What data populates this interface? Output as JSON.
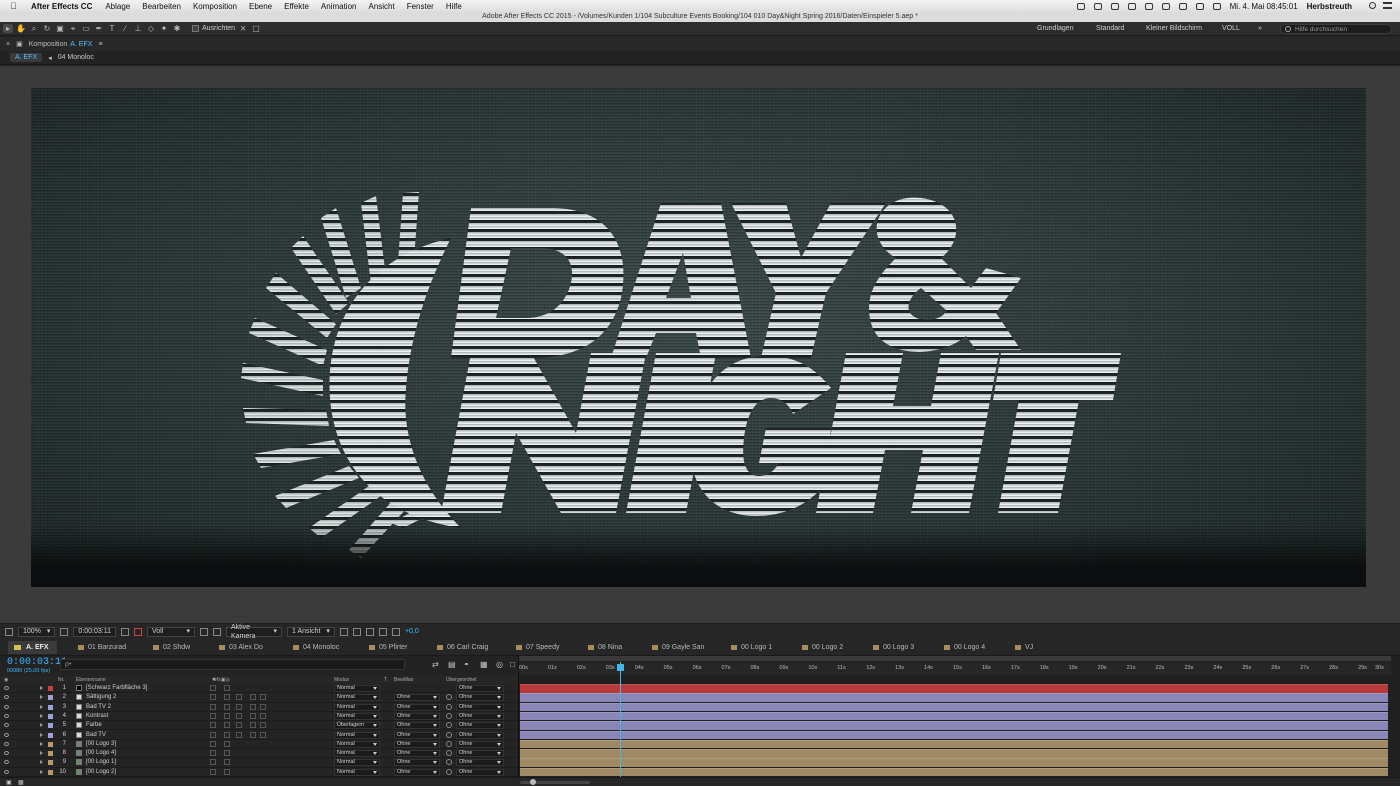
{
  "menubar": {
    "app_name": "After Effects CC",
    "items": [
      "Ablage",
      "Bearbeiten",
      "Komposition",
      "Ebene",
      "Effekte",
      "Animation",
      "Ansicht",
      "Fenster",
      "Hilfe"
    ],
    "clock": "Mi. 4. Mai  08:45:01",
    "user": "Herbstreuth"
  },
  "window_title": "Adobe After Effects CC 2015 - /Volumes/Kunden 1/104 Subculture Events Booking/104 010 Day&Night Spring 2016/Daten/Einspieler 5.aep *",
  "toolbar": {
    "snap_label": "Ausrichten",
    "workspaces": [
      "Grundlagen",
      "Standard",
      "Kleiner Bildschirm",
      "VOLL"
    ],
    "search_placeholder": "Hilfe durchsuchen"
  },
  "composition_panel": {
    "header_label": "Komposition",
    "comp_name": "A. EFX",
    "breadcrumb": [
      "A. EFX",
      "04 Monoloc"
    ]
  },
  "viewer_controls": {
    "zoom": "100%",
    "timecode": "0:00:03:11",
    "resolution": "Voll",
    "camera": "Aktive Kamera",
    "views": "1 Ansicht",
    "exposure": "+0,0"
  },
  "timeline_tabs": [
    "A. EFX",
    "01 Barzurad",
    "02 Shdw",
    "03 Alex Do",
    "04 Monoloc",
    "05 Pfirter",
    "06 Carl Craig",
    "07 Speedy",
    "08 Nina",
    "09 Gayle San",
    "00 Logo 1",
    "00 Logo 2",
    "00 Logo 3",
    "00 Logo 4",
    "VJ"
  ],
  "timeline": {
    "current_time": "0:00:03:11",
    "frame_info": "00086 (25.00 fps)",
    "search_placeholder": "ρ•",
    "columns": {
      "nr": "Nr.",
      "name": "Ebenenname",
      "modes": "Modus",
      "t": "T",
      "trkmat": "BewMas",
      "parent": "Übergeordnet"
    },
    "ruler": [
      "00s",
      "01s",
      "02s",
      "03s",
      "04s",
      "05s",
      "06s",
      "07s",
      "08s",
      "09s",
      "10s",
      "11s",
      "12s",
      "13s",
      "14s",
      "15s",
      "16s",
      "17s",
      "18s",
      "19s",
      "20s",
      "21s",
      "22s",
      "23s",
      "24s",
      "25s",
      "26s",
      "27s",
      "28s",
      "29s",
      "30s"
    ],
    "playhead_seconds": 3.44,
    "layers": [
      {
        "num": "1",
        "name": "[Schwarz Farbfläche 3]",
        "mode": "Normal",
        "trkmat": "",
        "parent": "Ohne",
        "label_color": "#c84040"
      },
      {
        "num": "2",
        "name": "Sättigung 2",
        "mode": "Normal",
        "trkmat": "Ohne",
        "parent": "Ohne",
        "label_color": "#a0a0d8"
      },
      {
        "num": "3",
        "name": "Bad TV 2",
        "mode": "Normal",
        "trkmat": "Ohne",
        "parent": "Ohne",
        "label_color": "#a0a0d8"
      },
      {
        "num": "4",
        "name": "Kontrast",
        "mode": "Normal",
        "trkmat": "Ohne",
        "parent": "Ohne",
        "label_color": "#a0a0d8"
      },
      {
        "num": "5",
        "name": "Farbe",
        "mode": "Überlagern",
        "trkmat": "Ohne",
        "parent": "Ohne",
        "label_color": "#a0a0d8"
      },
      {
        "num": "6",
        "name": "Bad TV",
        "mode": "Normal",
        "trkmat": "Ohne",
        "parent": "Ohne",
        "label_color": "#a0a0d8"
      },
      {
        "num": "7",
        "name": "[00 Logo 3]",
        "mode": "Normal",
        "trkmat": "Ohne",
        "parent": "Ohne",
        "label_color": "#b89a68"
      },
      {
        "num": "8",
        "name": "[00 Logo 4]",
        "mode": "Normal",
        "trkmat": "Ohne",
        "parent": "Ohne",
        "label_color": "#b89a68"
      },
      {
        "num": "9",
        "name": "[00 Logo 1]",
        "mode": "Normal",
        "trkmat": "Ohne",
        "parent": "Ohne",
        "label_color": "#b89a68"
      },
      {
        "num": "10",
        "name": "[00 Logo 2]",
        "mode": "Normal",
        "trkmat": "Ohne",
        "parent": "Ohne",
        "label_color": "#b89a68"
      }
    ]
  },
  "colors": {
    "accent": "#3bb8ff",
    "bar_red": "#b83a3a",
    "bar_purple": "#8b86b8",
    "bar_tan": "#a08a66"
  }
}
